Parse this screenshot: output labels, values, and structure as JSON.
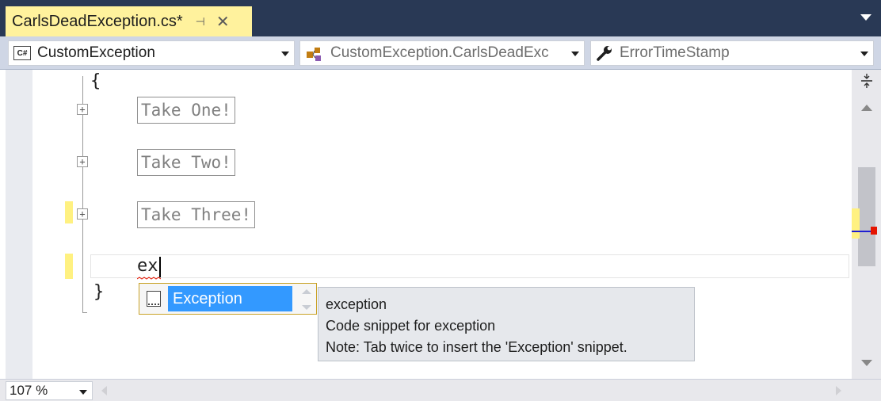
{
  "tab": {
    "title": "CarlsDeadException.cs*",
    "pin_glyph": "⊣",
    "close_glyph": "✕",
    "active_color": "#fff29d"
  },
  "navbar": {
    "project_combo": {
      "icon": "csharp-file-icon",
      "icon_text": "C#",
      "value": "CustomException"
    },
    "type_combo": {
      "icon": "class-member-icon",
      "value": "CustomException.CarlsDeadExc"
    },
    "member_combo": {
      "icon": "wrench-icon",
      "value": "ErrorTimeStamp"
    }
  },
  "editor": {
    "open_brace": "{",
    "close_brace": "}",
    "collapsed_regions": [
      {
        "label": "Take One!"
      },
      {
        "label": "Take Two!"
      },
      {
        "label": "Take Three!"
      }
    ],
    "expander_glyph": "+",
    "typed_text": "ex",
    "change_marker_color": "#fff181"
  },
  "completion": {
    "item_icon": "code-snippet-icon",
    "item_label": "Exception",
    "selection_color": "#3399ff"
  },
  "tooltip": {
    "title": "exception",
    "description": "Code snippet for exception",
    "note": "Note: Tab twice to insert the 'Exception' snippet."
  },
  "statusbar": {
    "zoom": "107 %"
  }
}
